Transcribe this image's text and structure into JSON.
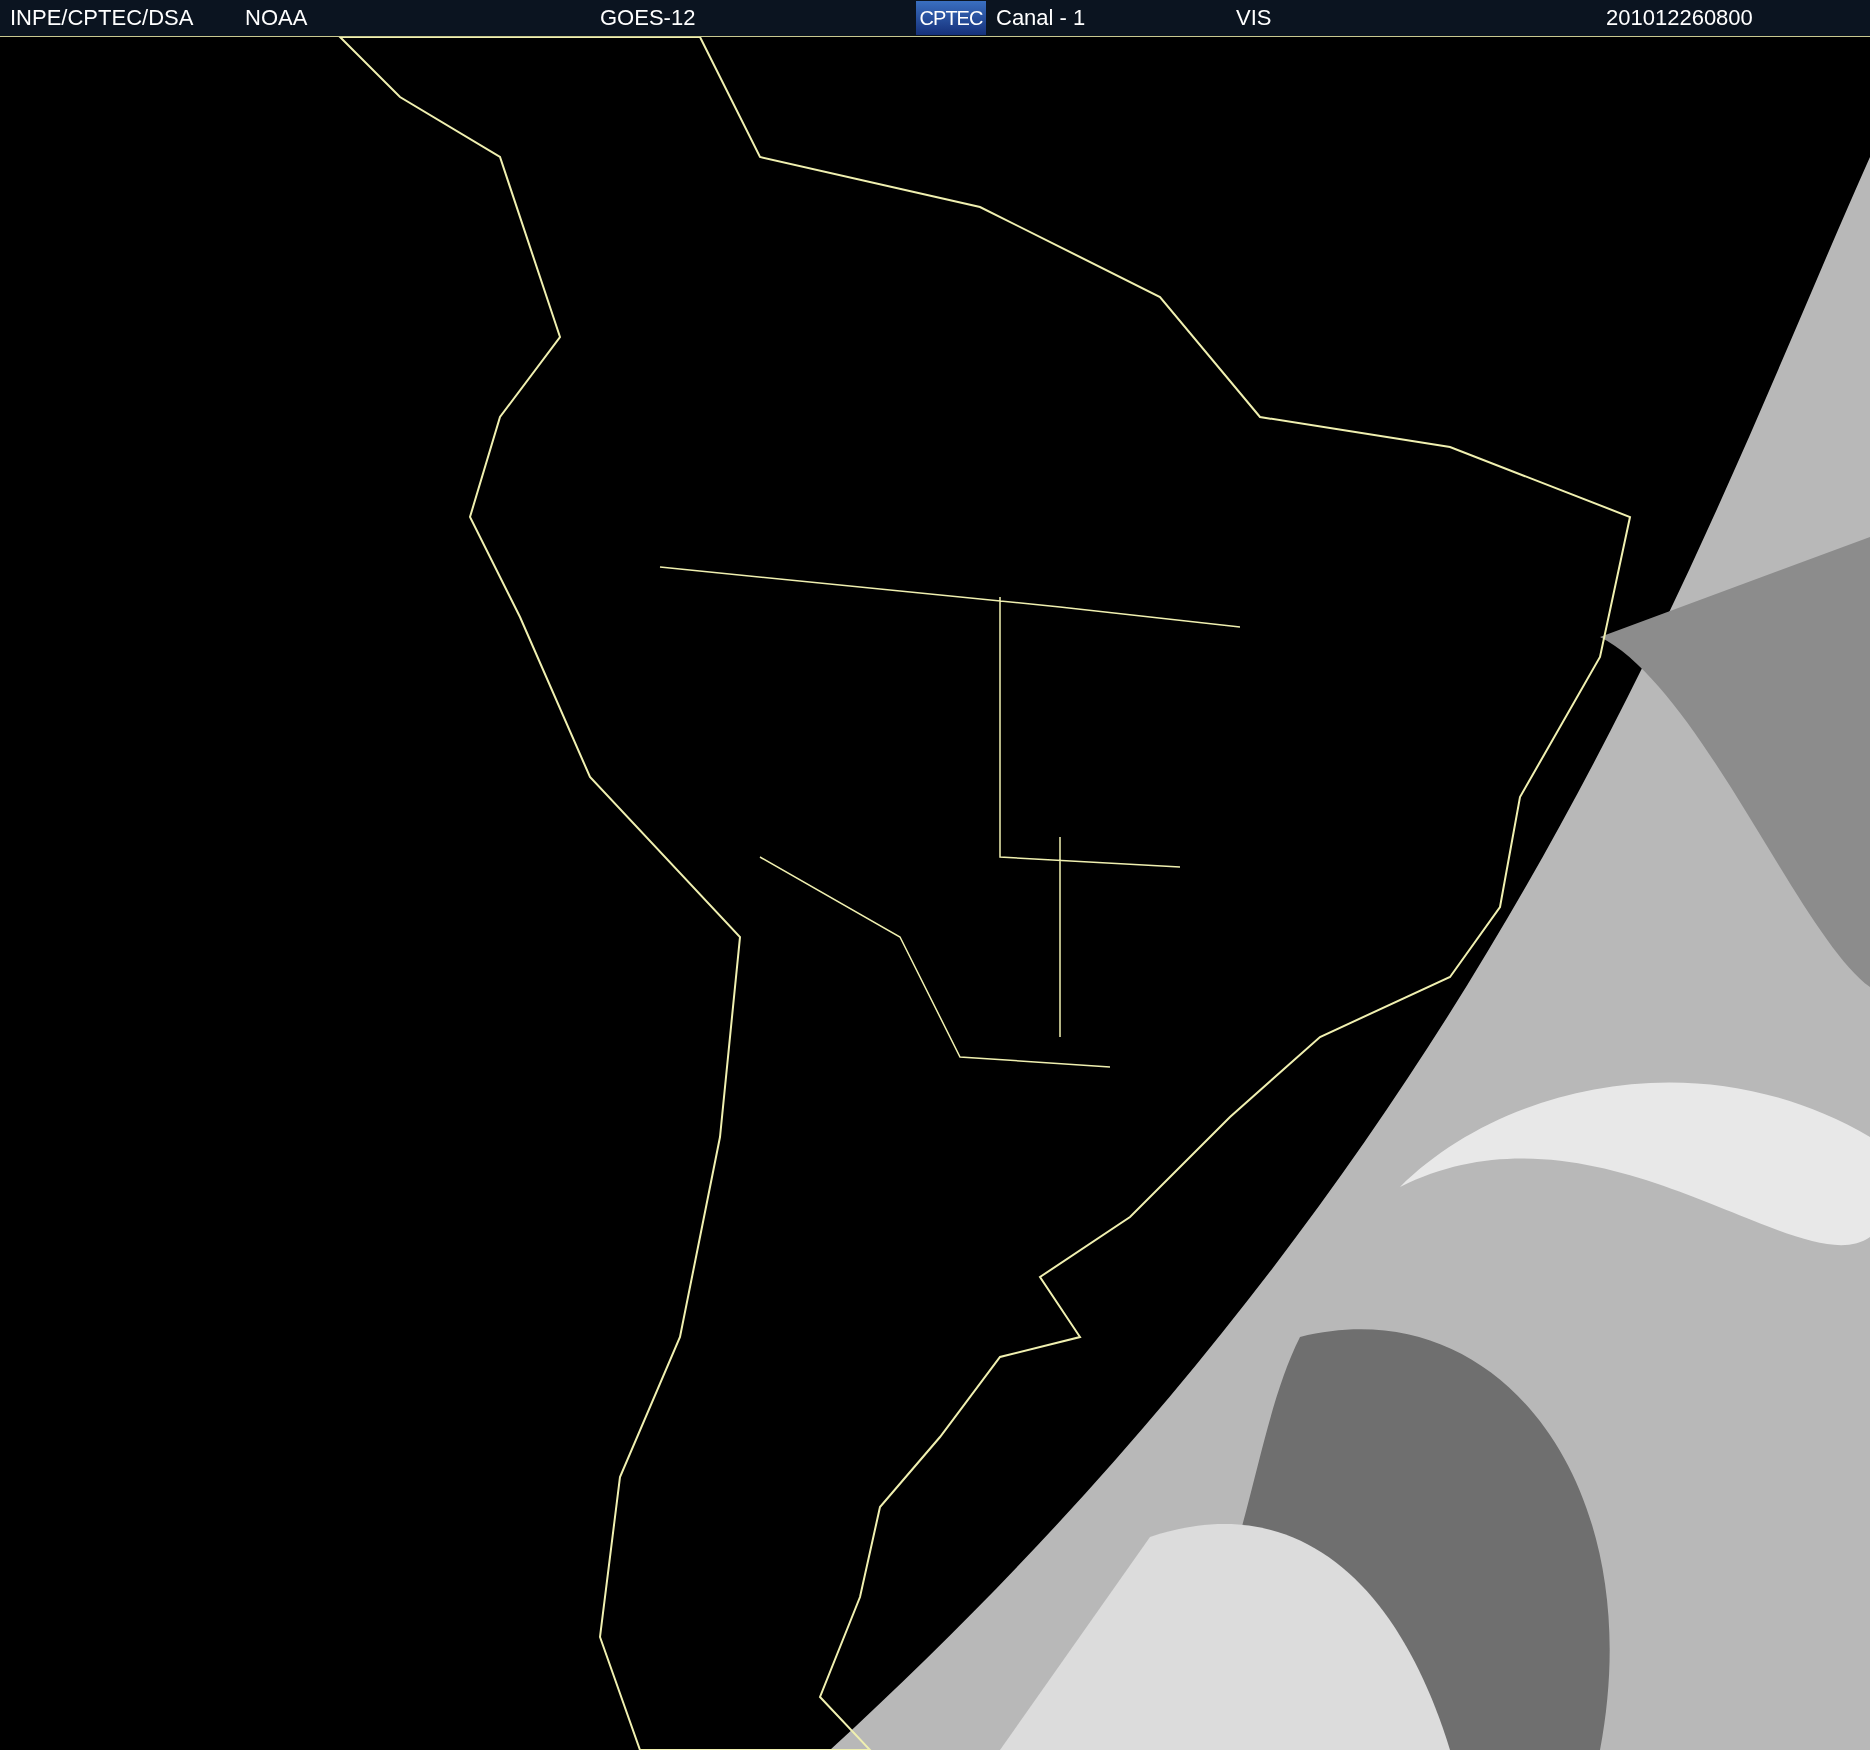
{
  "header": {
    "items": [
      {
        "kind": "text",
        "text": "INPE/CPTEC/DSA"
      },
      {
        "kind": "text",
        "text": "NOAA"
      },
      {
        "kind": "text",
        "text": "GOES-12"
      },
      {
        "kind": "logo",
        "text": "CPTEC"
      },
      {
        "kind": "text",
        "text": "Canal - 1"
      },
      {
        "kind": "text",
        "text": "VIS"
      },
      {
        "kind": "text",
        "text": "201012260800"
      }
    ]
  }
}
